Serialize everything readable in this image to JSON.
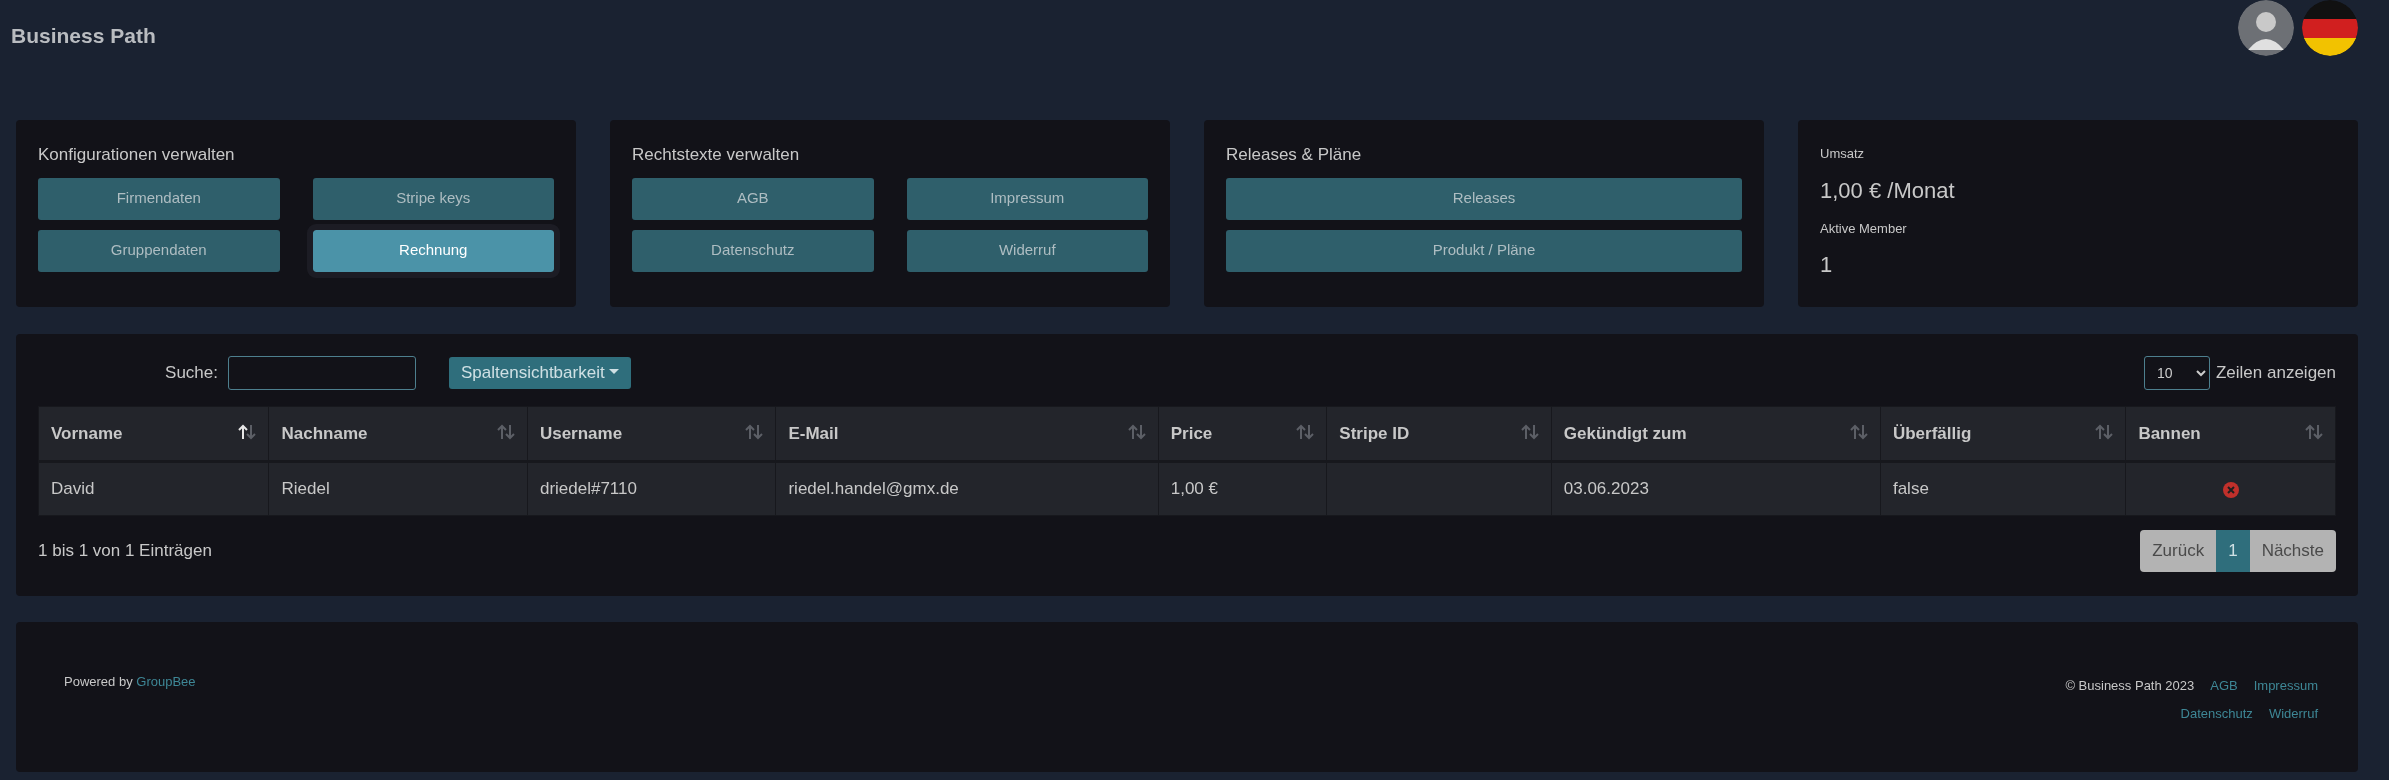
{
  "header": {
    "title": "Business Path"
  },
  "cards": [
    {
      "title": "Konfigurationen verwalten",
      "buttons": [
        {
          "label": "Firmendaten",
          "selected": false
        },
        {
          "label": "Stripe keys",
          "selected": false
        },
        {
          "label": "Gruppendaten",
          "selected": false
        },
        {
          "label": "Rechnung",
          "selected": true
        }
      ]
    },
    {
      "title": "Rechtstexte verwalten",
      "buttons": [
        {
          "label": "AGB",
          "selected": false
        },
        {
          "label": "Impressum",
          "selected": false
        },
        {
          "label": "Datenschutz",
          "selected": false
        },
        {
          "label": "Widerruf",
          "selected": false
        }
      ]
    },
    {
      "title": "Releases & Pläne",
      "buttons": [
        {
          "label": "Releases",
          "selected": false
        },
        {
          "label": "Produkt / Pläne",
          "selected": false
        }
      ]
    }
  ],
  "stats": [
    {
      "label": "Umsatz",
      "value": "1,00 € /Monat"
    },
    {
      "label": "Aktive Member",
      "value": "1"
    }
  ],
  "table": {
    "search_label": "Suche:",
    "column_toggle": "Spaltensichtbarkeit",
    "page_size": "10",
    "page_size_label": "Zeilen anzeigen",
    "columns": [
      {
        "label": "Vorname",
        "sorted": true
      },
      {
        "label": "Nachname",
        "sorted": false
      },
      {
        "label": "Username",
        "sorted": false
      },
      {
        "label": "E-Mail",
        "sorted": false
      },
      {
        "label": "Price",
        "sorted": false
      },
      {
        "label": "Stripe ID",
        "sorted": false
      },
      {
        "label": "Gekündigt zum",
        "sorted": false
      },
      {
        "label": "Überfällig",
        "sorted": false
      },
      {
        "label": "Bannen",
        "sorted": false
      }
    ],
    "rows": [
      {
        "cells": [
          {
            "kind": "text",
            "text": "David"
          },
          {
            "kind": "text",
            "text": "Riedel"
          },
          {
            "kind": "text",
            "text": "driedel#7110"
          },
          {
            "kind": "text",
            "text": "riedel.handel@gmx.de"
          },
          {
            "kind": "text",
            "text": "1,00 €"
          },
          {
            "kind": "blank"
          },
          {
            "kind": "text",
            "text": "03.06.2023"
          },
          {
            "kind": "text",
            "text": "false"
          },
          {
            "kind": "ban"
          }
        ]
      }
    ],
    "info": "1 bis 1 von 1 Einträgen",
    "pagination": [
      {
        "label": "Zurück",
        "selected": false
      },
      {
        "label": "1",
        "selected": true
      },
      {
        "label": "Nächste",
        "selected": false
      }
    ]
  },
  "footer": {
    "powered_by": "Powered by",
    "powered_link": "GroupBee",
    "copyright": "© Business Path 2023",
    "links": [
      [
        "AGB",
        "Impressum"
      ],
      [
        "Datenschutz",
        "Widerruf"
      ]
    ]
  }
}
